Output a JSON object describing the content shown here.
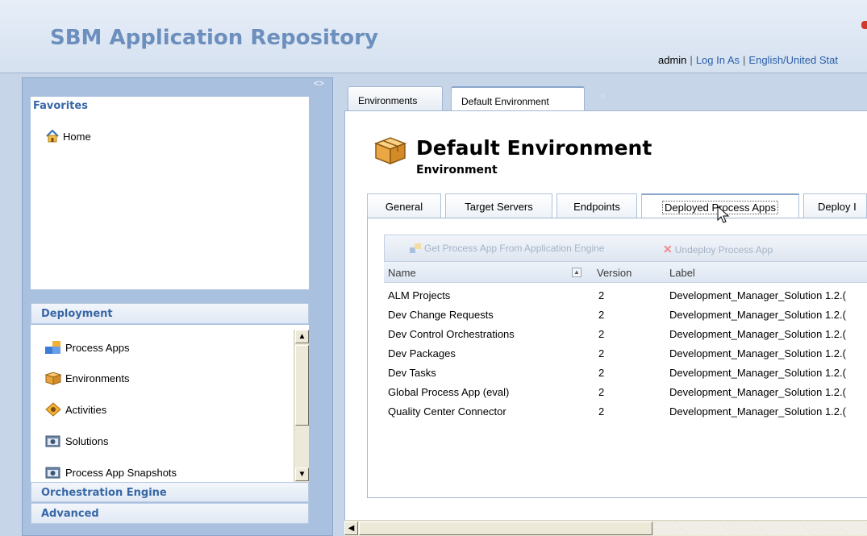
{
  "header": {
    "app_title": "SBM Application Repository",
    "user": "admin",
    "login_as": "Log In As",
    "locale": "English/United Stat"
  },
  "sidebar": {
    "toggle_symbol": "<>",
    "favorites": {
      "title": "Favorites",
      "items": [
        {
          "label": "Home",
          "icon": "home-icon"
        }
      ]
    },
    "deployment": {
      "title": "Deployment",
      "items": [
        {
          "label": "Process Apps",
          "icon": "process-apps-icon"
        },
        {
          "label": "Environments",
          "icon": "environment-box-icon"
        },
        {
          "label": "Activities",
          "icon": "activities-icon"
        },
        {
          "label": "Solutions",
          "icon": "solutions-icon"
        },
        {
          "label": "Process App Snapshots",
          "icon": "snapshots-icon"
        }
      ]
    },
    "orchestration_engine": {
      "title": "Orchestration Engine"
    },
    "advanced": {
      "title": "Advanced"
    }
  },
  "top_tabs": [
    {
      "label": "Environments"
    },
    {
      "label": "Default Environment",
      "active": true
    }
  ],
  "environment": {
    "title": "Default Environment",
    "subtitle": "Environment"
  },
  "sub_tabs": [
    {
      "label": "General"
    },
    {
      "label": "Target Servers"
    },
    {
      "label": "Endpoints"
    },
    {
      "label": "Deployed Process Apps",
      "active": true
    },
    {
      "label": "Deploy I"
    }
  ],
  "toolbar": {
    "get_label": "Get Process App From Application Engine",
    "undeploy_label": "Undeploy Process App"
  },
  "table": {
    "columns": [
      "Name",
      "Version",
      "Label"
    ],
    "rows": [
      {
        "name": "ALM Projects",
        "version": "2",
        "label": "Development_Manager_Solution 1.2.("
      },
      {
        "name": "Dev Change Requests",
        "version": "2",
        "label": "Development_Manager_Solution 1.2.("
      },
      {
        "name": "Dev Control Orchestrations",
        "version": "2",
        "label": "Development_Manager_Solution 1.2.("
      },
      {
        "name": "Dev Packages",
        "version": "2",
        "label": "Development_Manager_Solution 1.2.("
      },
      {
        "name": "Dev Tasks",
        "version": "2",
        "label": "Development_Manager_Solution 1.2.("
      },
      {
        "name": "Global Process App (eval)",
        "version": "2",
        "label": "Development_Manager_Solution 1.2.("
      },
      {
        "name": "Quality Center Connector",
        "version": "2",
        "label": "Development_Manager_Solution 1.2.("
      }
    ]
  },
  "colors": {
    "header_title": "#6c8fbd",
    "section_title": "#3867a6",
    "link": "#2a5fa8",
    "panel_bg": "#c6d5e8"
  }
}
